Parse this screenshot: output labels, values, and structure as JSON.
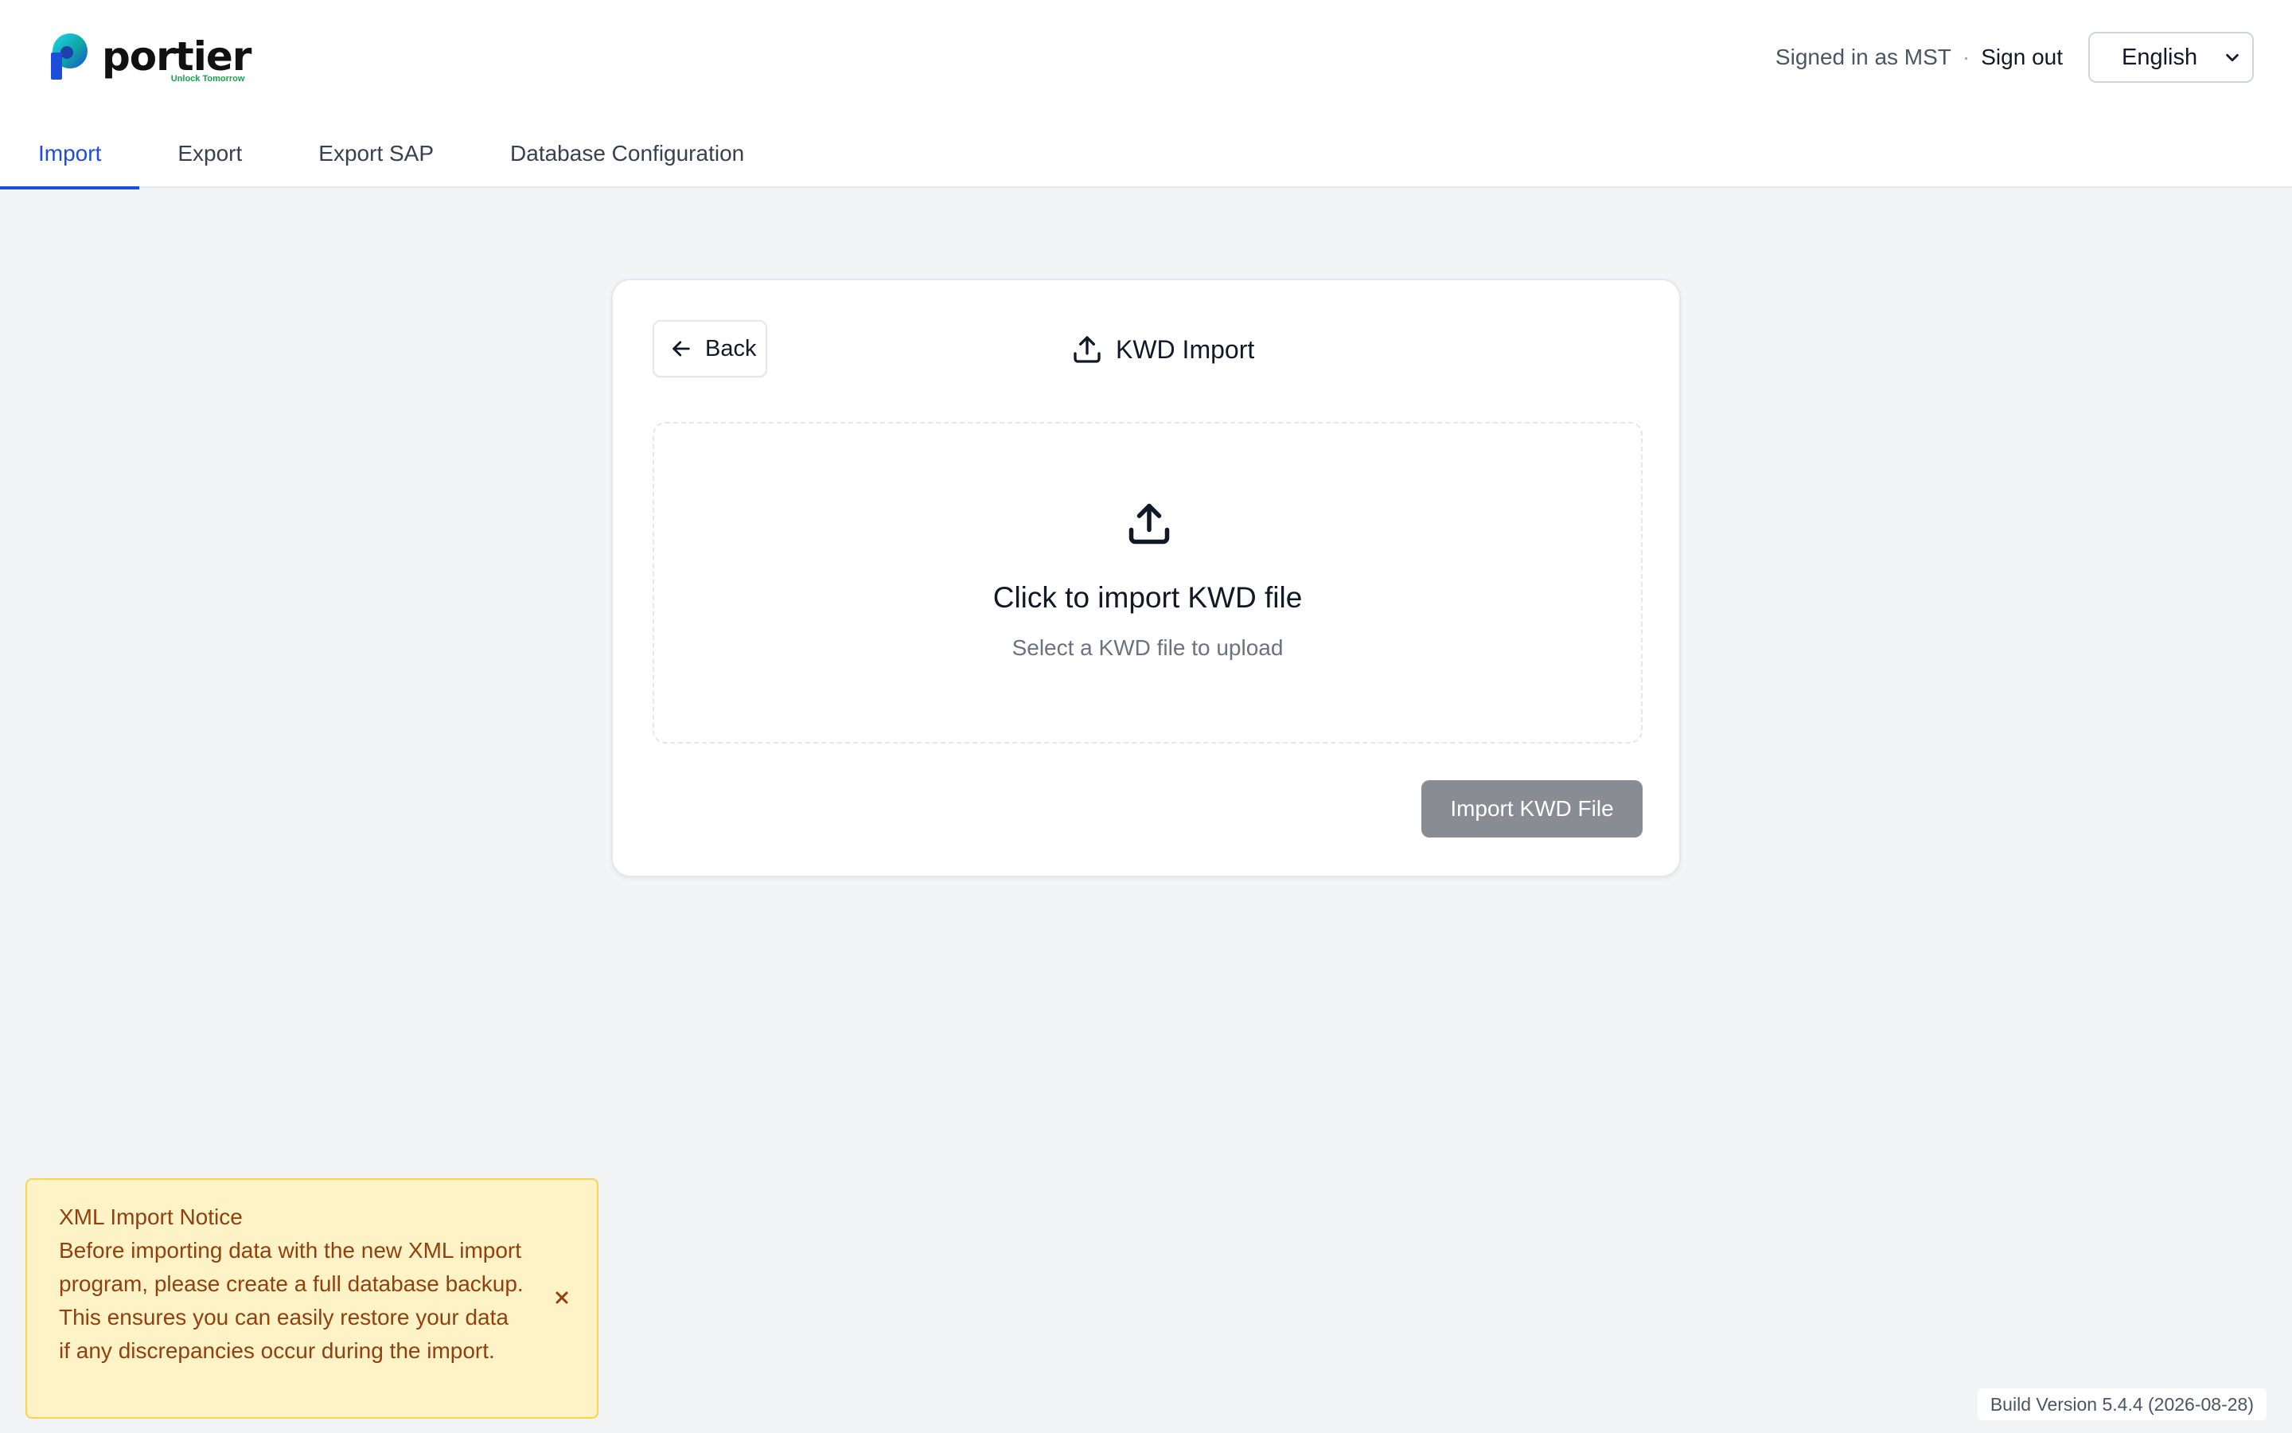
{
  "header": {
    "logo_text": "portier",
    "logo_tagline": "Unlock Tomorrow",
    "signed_in_text": "Signed in as MST",
    "separator": "·",
    "sign_out_label": "Sign out",
    "language_selected": "English"
  },
  "tabs": [
    {
      "label": "Import",
      "active": true
    },
    {
      "label": "Export",
      "active": false
    },
    {
      "label": "Export SAP",
      "active": false
    },
    {
      "label": "Database Configuration",
      "active": false
    }
  ],
  "card": {
    "back_label": "Back",
    "title": "KWD Import",
    "dropzone_title": "Click to import KWD file",
    "dropzone_subtitle": "Select a KWD file to upload",
    "import_button_label": "Import KWD File"
  },
  "notice": {
    "title": "XML Import Notice",
    "body": "Before importing data with the new XML import program, please create a full database backup. This ensures you can easily restore your data if any discrepancies occur during the import."
  },
  "footer": {
    "build_version": "Build Version 5.4.4 (2026-08-28)"
  },
  "colors": {
    "accent": "#1d4ed8",
    "page_bg": "#f3f4f6",
    "notice_bg": "#fef3c7",
    "notice_text": "#92400e",
    "button_disabled": "#8a8c93"
  },
  "icons": {
    "logo": "portier-logo-icon",
    "back": "arrow-left-icon",
    "title": "upload-icon",
    "dropzone": "upload-icon",
    "close": "close-icon",
    "select": "chevron-down-icon"
  }
}
